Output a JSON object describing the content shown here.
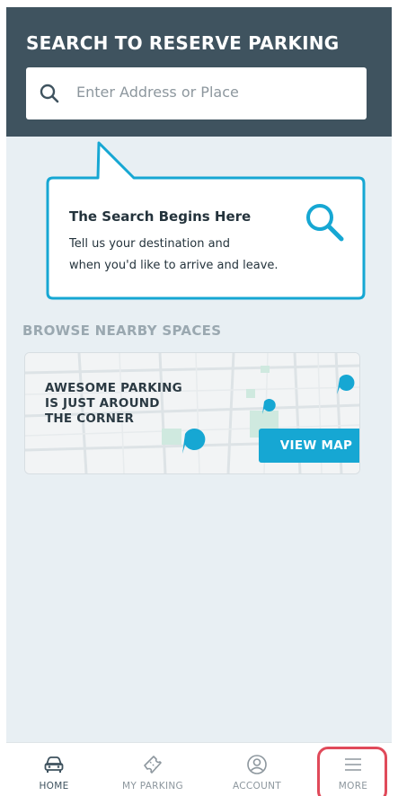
{
  "header": {
    "title": "SEARCH TO RESERVE PARKING",
    "search_placeholder": "Enter Address or Place"
  },
  "callout": {
    "title": "The Search Begins Here",
    "line1": "Tell us your destination and",
    "line2": "when you'd like to arrive and leave."
  },
  "browse": {
    "label": "BROWSE NEARBY SPACES",
    "headline_line1": "AWESOME PARKING",
    "headline_line2": "IS JUST AROUND",
    "headline_line3": "THE CORNER",
    "view_map_label": "VIEW MAP"
  },
  "tabs": [
    {
      "label": "HOME",
      "icon": "car-icon"
    },
    {
      "label": "MY PARKING",
      "icon": "ticket-icon"
    },
    {
      "label": "ACCOUNT",
      "icon": "user-circle-icon"
    },
    {
      "label": "MORE",
      "icon": "menu-icon"
    }
  ],
  "colors": {
    "header_bg": "#3f535f",
    "accent": "#16a7d3",
    "highlight": "#e04a5a",
    "screen_bg": "#e8eff3"
  }
}
